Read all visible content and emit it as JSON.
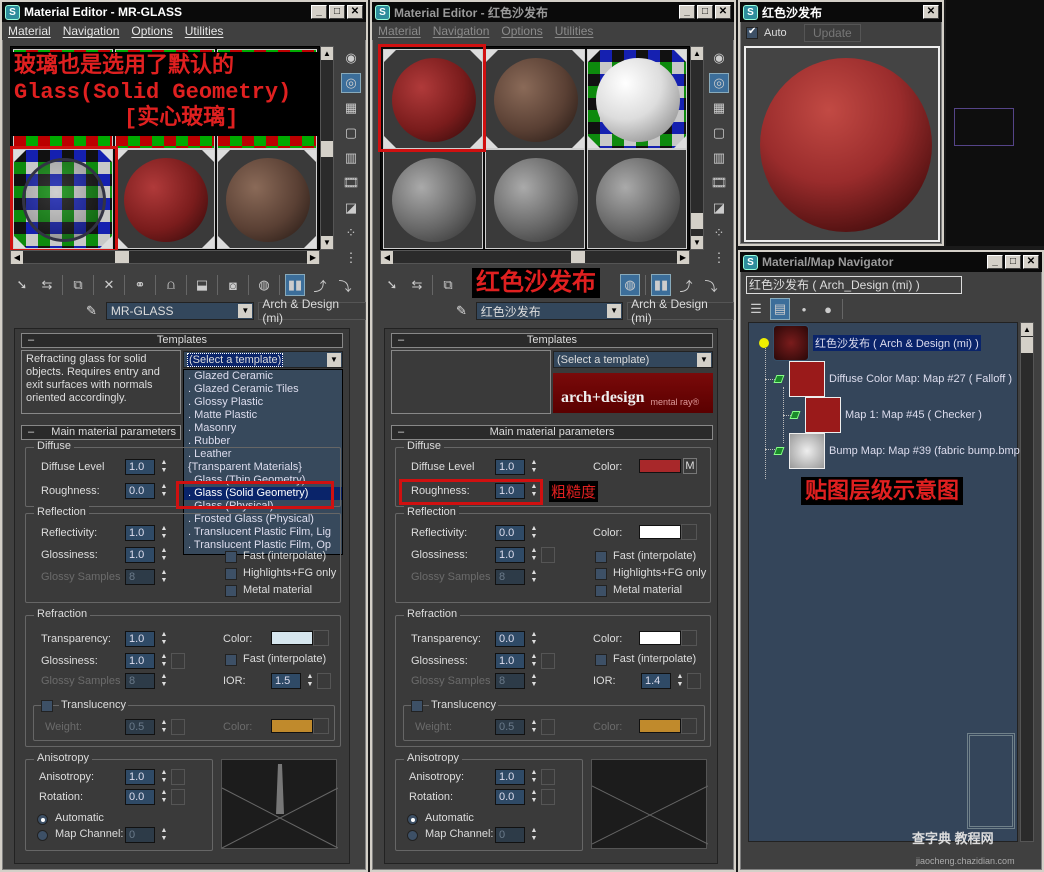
{
  "left_editor": {
    "title": "Material Editor - MR-GLASS",
    "menu": [
      "Material",
      "Navigation",
      "Options",
      "Utilities"
    ],
    "overlay_lines": [
      "玻璃也是选用了默认的",
      "Glass(Solid Geometry)",
      "[实心玻璃]"
    ],
    "material_name": "MR-GLASS",
    "material_type": "Arch & Design (mi)",
    "templates": {
      "header": "Templates",
      "description": "Refracting glass for solid objects. Requires entry and exit surfaces with normals oriented accordingly.",
      "select_value": "(Select a template)",
      "list": [
        ".   Glazed Ceramic",
        ".   Glazed Ceramic Tiles",
        ".   Glossy Plastic",
        ".   Matte Plastic",
        ".   Masonry",
        ".   Rubber",
        ".   Leather",
        "{Transparent Materials}",
        ".   Glass (Thin Geometry)",
        ".   Glass (Solid Geometry)",
        ".   Glass (Physical)",
        ".   Frosted Glass (Physical)",
        ".   Translucent Plastic Film, Lig",
        ".   Translucent Plastic Film, Op"
      ],
      "selected_index": 9
    },
    "main_header": "Main material parameters",
    "diffuse": {
      "title": "Diffuse",
      "level_label": "Diffuse Level",
      "level": "1.0",
      "roughness_label": "Roughness:",
      "roughness": "0.0"
    },
    "reflection": {
      "title": "Reflection",
      "reflectivity_label": "Reflectivity:",
      "reflectivity": "1.0",
      "glossiness_label": "Glossiness:",
      "glossiness": "1.0",
      "samples_label": "Glossy Samples",
      "samples": "8",
      "fast_label": "Fast (interpolate)",
      "hfg_label": "Highlights+FG only",
      "metal_label": "Metal material"
    },
    "refraction": {
      "title": "Refraction",
      "transparency_label": "Transparency:",
      "transparency": "1.0",
      "glossiness_label": "Glossiness:",
      "glossiness": "1.0",
      "samples_label": "Glossy Samples",
      "samples": "8",
      "color_label": "Color:",
      "color": "#d6e6ee",
      "fast_label": "Fast (interpolate)",
      "ior_label": "IOR:",
      "ior": "1.5"
    },
    "translucency": {
      "title": "Translucency",
      "weight_label": "Weight:",
      "weight": "0.5",
      "color_label": "Color:",
      "color": "#c08a2c"
    },
    "anisotropy": {
      "title": "Anisotropy",
      "aniso_label": "Anisotropy:",
      "aniso": "1.0",
      "rotation_label": "Rotation:",
      "rotation": "0.0",
      "automatic_label": "Automatic",
      "mapch_label": "Map Channel:",
      "mapch": "0"
    }
  },
  "mid_editor": {
    "title": "Material Editor - 红色沙发布",
    "menu": [
      "Material",
      "Navigation",
      "Options",
      "Utilities"
    ],
    "toolbar_overlay": "红色沙发布",
    "material_name": "红色沙发布",
    "material_type": "Arch & Design (mi)",
    "templates": {
      "header": "Templates",
      "select_value": "(Select a template)",
      "logo_main": "arch+design",
      "logo_sub": "mental ray®"
    },
    "main_header": "Main material parameters",
    "diffuse": {
      "title": "Diffuse",
      "level_label": "Diffuse Level",
      "level": "1.0",
      "color_label": "Color:",
      "color": "#a8282a",
      "map_btn": "M",
      "roughness_label": "Roughness:",
      "roughness": "1.0",
      "roughness_annotation": "粗糙度"
    },
    "reflection": {
      "title": "Reflection",
      "reflectivity_label": "Reflectivity:",
      "reflectivity": "0.0",
      "color_label": "Color:",
      "color": "#ffffff",
      "glossiness_label": "Glossiness:",
      "glossiness": "1.0",
      "samples_label": "Glossy Samples",
      "samples": "8",
      "fast_label": "Fast (interpolate)",
      "hfg_label": "Highlights+FG only",
      "metal_label": "Metal material"
    },
    "refraction": {
      "title": "Refraction",
      "transparency_label": "Transparency:",
      "transparency": "0.0",
      "color_label": "Color:",
      "color": "#ffffff",
      "glossiness_label": "Glossiness:",
      "glossiness": "1.0",
      "fast_label": "Fast (interpolate)",
      "samples_label": "Glossy Samples",
      "samples": "8",
      "ior_label": "IOR:",
      "ior": "1.4"
    },
    "translucency": {
      "title": "Translucency",
      "weight_label": "Weight:",
      "weight": "0.5",
      "color_label": "Color:",
      "color": "#c08a2c"
    },
    "anisotropy": {
      "title": "Anisotropy",
      "aniso_label": "Anisotropy:",
      "aniso": "1.0",
      "rotation_label": "Rotation:",
      "rotation": "0.0",
      "automatic_label": "Automatic",
      "mapch_label": "Map Channel:",
      "mapch": "0"
    }
  },
  "preview": {
    "title": "红色沙发布",
    "auto_label": "Auto",
    "auto_checked": true,
    "update_label": "Update"
  },
  "navigator": {
    "title": "Material/Map Navigator",
    "path": "红色沙发布  ( Arch_Design (mi) )",
    "items": [
      {
        "label": "红色沙发布  ( Arch & Design (mi) )"
      },
      {
        "label": "Diffuse Color Map: Map #27  ( Falloff )"
      },
      {
        "label": "Map 1: Map #45  ( Checker )"
      },
      {
        "label": "Bump Map: Map #39 (fabric bump.bmp)"
      }
    ],
    "annotation": "贴图层级示意图"
  },
  "watermark": {
    "text": "查字典 教程网",
    "url": "jiaocheng.chazidian.com"
  }
}
